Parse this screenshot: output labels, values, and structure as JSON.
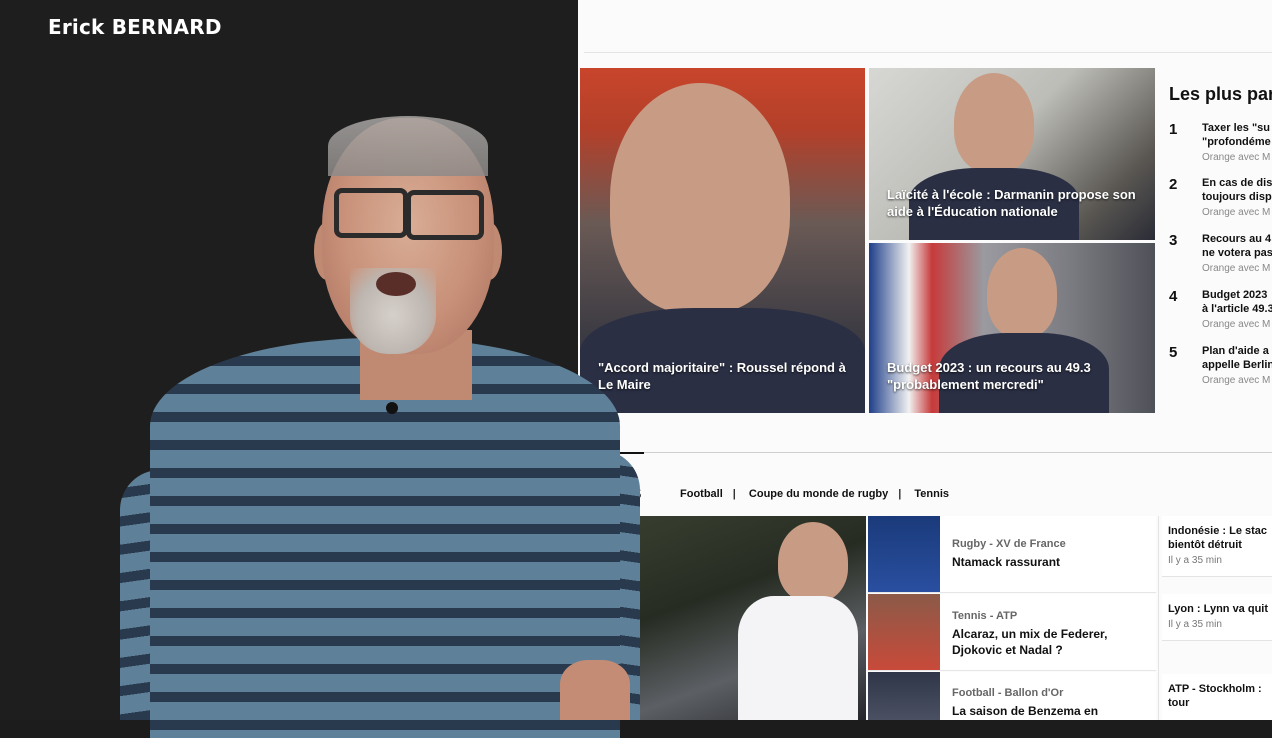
{
  "presenter": {
    "name": "Erick BERNARD"
  },
  "headlines": {
    "main": {
      "caption": "\"Accord majoritaire\" : Roussel répond à Le Maire"
    },
    "top_right": {
      "caption": "Laïcité à l'école : Darmanin propose son aide à l'Éducation nationale"
    },
    "bottom_right": {
      "caption": "Budget 2023 : un recours au 49.3 \"probablement mercredi\""
    }
  },
  "popular": {
    "title": "Les plus par",
    "items": [
      {
        "num": "1",
        "line1": "Taxer les \"su",
        "line2": "\"profondéme",
        "source": "Orange avec M"
      },
      {
        "num": "2",
        "line1": "En cas de dis",
        "line2": "toujours disp",
        "source": "Orange avec M"
      },
      {
        "num": "3",
        "line1": "Recours au 4",
        "line2": "ne votera pas",
        "source": "Orange avec M"
      },
      {
        "num": "4",
        "line1": "Budget 2023",
        "line2": "à l'article 49.3",
        "source": "Orange avec M"
      },
      {
        "num": "5",
        "line1": "Plan d'aide a",
        "line2": "appelle Berlin",
        "source": "Orange avec M"
      }
    ]
  },
  "sports": {
    "title": "orts",
    "nav": [
      "Football",
      "Coupe du monde de rugby",
      "Tennis"
    ],
    "articles": [
      {
        "category": "Rugby - XV de France",
        "title": "Ntamack rassurant",
        "title2": ""
      },
      {
        "category": "Tennis - ATP",
        "title": "Alcaraz, un mix de Federer,",
        "title2": "Djokovic et Nadal ?"
      },
      {
        "category": "Football - Ballon d'Or",
        "title": "La saison de Benzema en",
        "title2": ""
      }
    ],
    "side": [
      {
        "title": "Indonésie : Le stac",
        "title2": "bientôt détruit",
        "time": "Il y a 35 min"
      },
      {
        "title": "Lyon : Lynn va quit",
        "title2": "",
        "time": "Il y a 35 min"
      },
      {
        "title": "ATP - Stockholm :",
        "title2": "tour",
        "time": ""
      }
    ]
  }
}
